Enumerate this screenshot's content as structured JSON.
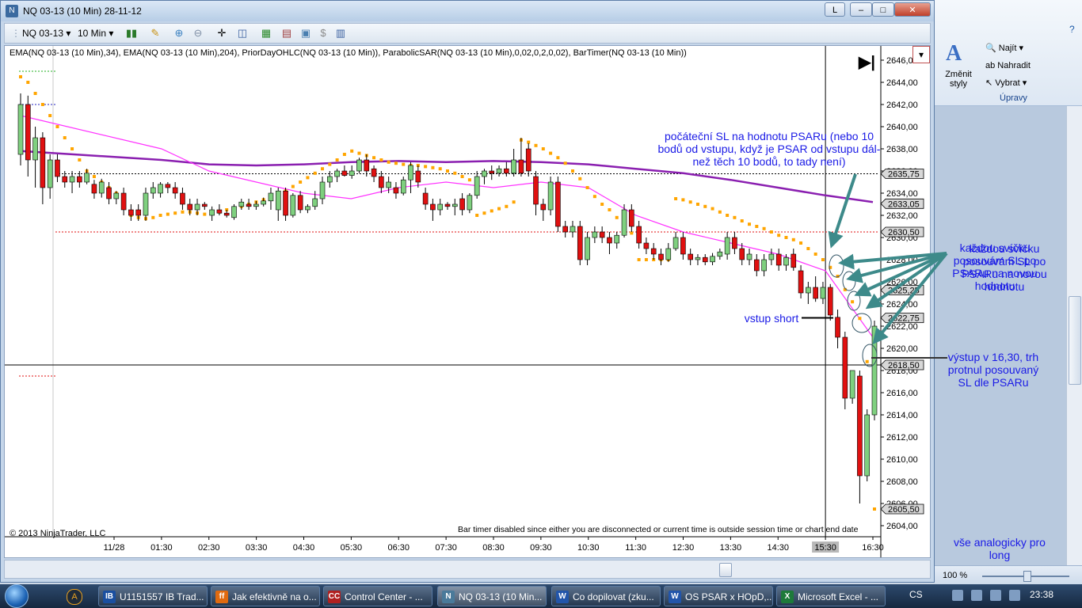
{
  "window": {
    "title": "NQ 03-13 (10 Min)  28-11-12",
    "link_button": "L",
    "minimize": "–",
    "maximize": "□",
    "close": "✕"
  },
  "toolbar": {
    "instrument": "NQ 03-13",
    "interval": "10 Min"
  },
  "chart": {
    "indicators_label": "EMA(NQ 03-13 (10 Min),34), EMA(NQ 03-13 (10 Min),204), PriorDayOHLC(NQ 03-13 (10 Min)), ParabolicSAR(NQ 03-13 (10 Min),0,02,0,2,0,02), BarTimer(NQ 03-13 (10 Min))",
    "copyright": "© 2013 NinjaTrader, LLC",
    "bar_timer_message": "Bar timer disabled since either you are disconnected or current time is outside session time or chart end date",
    "colors": {
      "up": "#7fd07f",
      "down": "#e01010",
      "ema34": "#ff33ff",
      "ema204": "#8a1fb0",
      "psar": "#ffa500",
      "annotation": "#1a1ae6",
      "arrow": "#3d8a8a"
    }
  },
  "chart_data": {
    "type": "candlestick",
    "instrument": "NQ 03-13",
    "interval": "10 Min",
    "y_axis": {
      "ylim": [
        2603,
        2647
      ],
      "ticks": [
        "2604,00",
        "2606,00",
        "2608,00",
        "2610,00",
        "2612,00",
        "2614,00",
        "2616,00",
        "2618,00",
        "2620,00",
        "2622,00",
        "2624,00",
        "2626,00",
        "2628,00",
        "2630,00",
        "2632,00",
        "2634,00",
        "2636,00",
        "2638,00",
        "2640,00",
        "2642,00",
        "2644,00",
        "2646,00"
      ]
    },
    "x_axis": {
      "ticks": [
        "11/28",
        "01:30",
        "02:30",
        "03:30",
        "04:30",
        "05:30",
        "06:30",
        "07:30",
        "08:30",
        "09:30",
        "10:30",
        "11:30",
        "12:30",
        "13:30",
        "14:30",
        "15:30",
        "16:30"
      ]
    },
    "price_markers": [
      "2635,75",
      "2633,05",
      "2630,50",
      "2625,25",
      "2622,75",
      "2618,50",
      "2605,50"
    ],
    "candles": [
      [
        2637.5,
        2643.0,
        2636.5,
        2642.0
      ],
      [
        2642.0,
        2642.8,
        2635.5,
        2637.0
      ],
      [
        2637.0,
        2640.0,
        2634.5,
        2639.0
      ],
      [
        2639.0,
        2639.5,
        2633.0,
        2634.5
      ],
      [
        2634.5,
        2637.5,
        2633.5,
        2637.0
      ],
      [
        2637.0,
        2637.5,
        2635.0,
        2635.5
      ],
      [
        2635.5,
        2636.0,
        2634.5,
        2635.0
      ],
      [
        2635.0,
        2636.0,
        2634.0,
        2635.5
      ],
      [
        2635.5,
        2636.0,
        2634.5,
        2635.0
      ],
      [
        2635.0,
        2636.2,
        2634.8,
        2635.8
      ],
      [
        2634.8,
        2635.2,
        2633.5,
        2634.0
      ],
      [
        2634.0,
        2635.3,
        2633.6,
        2635.0
      ],
      [
        2634.5,
        2635.0,
        2633.0,
        2633.5
      ],
      [
        2633.5,
        2634.2,
        2633.0,
        2634.0
      ],
      [
        2634.0,
        2634.5,
        2632.0,
        2632.5
      ],
      [
        2632.5,
        2633.0,
        2631.5,
        2632.0
      ],
      [
        2632.5,
        2633.0,
        2631.5,
        2632.0
      ],
      [
        2632.0,
        2634.5,
        2631.5,
        2634.0
      ],
      [
        2634.0,
        2635.0,
        2633.5,
        2634.5
      ],
      [
        2634.0,
        2635.0,
        2633.6,
        2634.8
      ],
      [
        2634.8,
        2635.0,
        2634.0,
        2634.5
      ],
      [
        2634.5,
        2635.0,
        2633.5,
        2634.0
      ],
      [
        2634.0,
        2634.5,
        2632.5,
        2633.0
      ],
      [
        2633.0,
        2633.5,
        2632.0,
        2632.5
      ],
      [
        2632.5,
        2633.5,
        2632.0,
        2633.0
      ],
      [
        2633.0,
        2633.2,
        2632.5,
        2632.8
      ],
      [
        2632.0,
        2632.8,
        2631.5,
        2632.5
      ],
      [
        2632.5,
        2633.0,
        2632.0,
        2632.2
      ],
      [
        2632.2,
        2632.5,
        2631.8,
        2632.0
      ],
      [
        2631.8,
        2633.0,
        2631.6,
        2632.8
      ],
      [
        2632.8,
        2633.5,
        2632.5,
        2633.2
      ],
      [
        2633.0,
        2633.5,
        2632.5,
        2632.8
      ],
      [
        2632.8,
        2633.3,
        2632.5,
        2633.0
      ],
      [
        2633.0,
        2633.6,
        2632.8,
        2633.3
      ],
      [
        2633.3,
        2634.5,
        2632.5,
        2634.0
      ],
      [
        2632.5,
        2634.5,
        2631.5,
        2634.2
      ],
      [
        2634.2,
        2634.5,
        2631.5,
        2632.0
      ],
      [
        2632.0,
        2634.0,
        2631.8,
        2633.8
      ],
      [
        2633.8,
        2634.2,
        2632.2,
        2632.5
      ],
      [
        2632.5,
        2633.0,
        2632.2,
        2632.8
      ],
      [
        2632.8,
        2634.2,
        2632.5,
        2633.5
      ],
      [
        2633.5,
        2635.5,
        2633.0,
        2635.0
      ],
      [
        2635.0,
        2636.0,
        2634.5,
        2635.5
      ],
      [
        2635.5,
        2636.2,
        2635.0,
        2636.0
      ],
      [
        2636.0,
        2636.5,
        2635.5,
        2635.6
      ],
      [
        2635.6,
        2636.5,
        2635.3,
        2636.0
      ],
      [
        2636.0,
        2637.2,
        2635.8,
        2637.0
      ],
      [
        2637.0,
        2637.5,
        2635.5,
        2636.0
      ],
      [
        2636.2,
        2636.5,
        2635.0,
        2635.5
      ],
      [
        2635.5,
        2636.0,
        2634.0,
        2634.5
      ],
      [
        2634.5,
        2635.5,
        2634.0,
        2635.0
      ],
      [
        2634.5,
        2635.0,
        2633.5,
        2634.0
      ],
      [
        2634.0,
        2635.5,
        2633.8,
        2635.2
      ],
      [
        2635.2,
        2636.8,
        2634.0,
        2636.5
      ],
      [
        2636.0,
        2636.5,
        2634.5,
        2635.0
      ],
      [
        2634.0,
        2634.5,
        2632.5,
        2633.0
      ],
      [
        2633.0,
        2633.5,
        2631.5,
        2632.5
      ],
      [
        2632.5,
        2633.5,
        2632.0,
        2633.0
      ],
      [
        2633.0,
        2633.2,
        2632.5,
        2632.8
      ],
      [
        2632.8,
        2633.5,
        2632.0,
        2633.0
      ],
      [
        2633.5,
        2634.0,
        2632.0,
        2632.5
      ],
      [
        2632.5,
        2634.0,
        2632.2,
        2633.8
      ],
      [
        2633.8,
        2636.0,
        2633.5,
        2635.5
      ],
      [
        2635.5,
        2636.2,
        2634.8,
        2636.0
      ],
      [
        2636.0,
        2636.5,
        2635.2,
        2635.8
      ],
      [
        2635.8,
        2636.5,
        2635.5,
        2636.2
      ],
      [
        2636.2,
        2636.8,
        2635.5,
        2635.8
      ],
      [
        2635.8,
        2638.0,
        2635.5,
        2637.0
      ],
      [
        2637.0,
        2639.0,
        2635.5,
        2635.8
      ],
      [
        2638.0,
        2638.5,
        2635.5,
        2636.0
      ],
      [
        2635.5,
        2636.0,
        2632.0,
        2633.0
      ],
      [
        2633.0,
        2633.5,
        2631.5,
        2632.5
      ],
      [
        2632.5,
        2635.5,
        2632.0,
        2635.0
      ],
      [
        2635.0,
        2635.5,
        2630.5,
        2631.0
      ],
      [
        2631.0,
        2631.5,
        2630.0,
        2630.5
      ],
      [
        2630.5,
        2631.5,
        2630.0,
        2631.0
      ],
      [
        2631.0,
        2631.5,
        2627.5,
        2628.0
      ],
      [
        2628.0,
        2630.5,
        2627.5,
        2630.0
      ],
      [
        2630.0,
        2631.0,
        2629.5,
        2630.5
      ],
      [
        2630.5,
        2631.0,
        2629.5,
        2630.0
      ],
      [
        2630.0,
        2630.5,
        2628.5,
        2629.5
      ],
      [
        2629.5,
        2630.5,
        2629.0,
        2630.2
      ],
      [
        2630.2,
        2633.0,
        2630.0,
        2632.5
      ],
      [
        2632.5,
        2633.0,
        2630.5,
        2631.0
      ],
      [
        2631.0,
        2631.5,
        2629.0,
        2629.5
      ],
      [
        2629.5,
        2630.0,
        2628.5,
        2629.0
      ],
      [
        2629.0,
        2629.5,
        2628.0,
        2628.5
      ],
      [
        2628.5,
        2629.0,
        2627.5,
        2628.0
      ],
      [
        2628.0,
        2629.5,
        2627.8,
        2629.0
      ],
      [
        2629.0,
        2630.5,
        2628.8,
        2630.0
      ],
      [
        2630.0,
        2630.5,
        2628.0,
        2628.5
      ],
      [
        2628.5,
        2629.0,
        2627.5,
        2628.0
      ],
      [
        2628.0,
        2628.5,
        2627.5,
        2628.2
      ],
      [
        2628.2,
        2628.5,
        2627.5,
        2627.8
      ],
      [
        2627.8,
        2628.6,
        2627.5,
        2628.3
      ],
      [
        2628.3,
        2629.0,
        2628.0,
        2628.7
      ],
      [
        2628.5,
        2630.5,
        2628.0,
        2630.0
      ],
      [
        2630.0,
        2630.5,
        2628.5,
        2629.0
      ],
      [
        2629.0,
        2629.5,
        2627.5,
        2628.0
      ],
      [
        2628.0,
        2629.0,
        2627.5,
        2628.5
      ],
      [
        2628.0,
        2628.5,
        2626.5,
        2627.0
      ],
      [
        2627.0,
        2628.5,
        2626.5,
        2628.0
      ],
      [
        2628.0,
        2629.0,
        2627.5,
        2628.5
      ],
      [
        2628.5,
        2629.0,
        2627.0,
        2627.5
      ],
      [
        2627.5,
        2628.5,
        2627.0,
        2628.2
      ],
      [
        2628.5,
        2629.0,
        2627.0,
        2627.3
      ],
      [
        2627.0,
        2627.5,
        2624.5,
        2625.0
      ],
      [
        2625.0,
        2626.0,
        2624.0,
        2625.5
      ],
      [
        2625.5,
        2626.5,
        2624.2,
        2624.5
      ],
      [
        2624.5,
        2626.0,
        2624.0,
        2625.5
      ],
      [
        2625.5,
        2625.8,
        2622.5,
        2623.0
      ],
      [
        2622.8,
        2623.5,
        2620.0,
        2621.0
      ],
      [
        2621.0,
        2621.5,
        2614.5,
        2615.5
      ],
      [
        2615.5,
        2618.0,
        2615.0,
        2618.0
      ],
      [
        2617.5,
        2618.0,
        2606.0,
        2608.5
      ],
      [
        2608.5,
        2614.5,
        2608.0,
        2614.0
      ],
      [
        2614.0,
        2622.5,
        2613.5,
        2622.0
      ]
    ],
    "ema34_at_ticks": [
      2641.0,
      2638.0,
      2636.0,
      2635.0,
      2634.0,
      2633.5,
      2634.5,
      2635.0,
      2634.5,
      2635.0,
      2634.5,
      2632.0,
      2630.5,
      2629.5,
      2628.5,
      2627.0,
      2621.0
    ],
    "ema204_at_ticks": [
      2637.8,
      2637.0,
      2636.6,
      2636.5,
      2636.6,
      2636.8,
      2636.9,
      2636.8,
      2636.9,
      2636.8,
      2636.6,
      2636.2,
      2635.8,
      2635.2,
      2634.5,
      2633.8,
      2633.2
    ],
    "psar": [
      2644.5,
      2644.0,
      2643.0,
      2642.0,
      2641.0,
      2640.0,
      2639.0,
      2638.0,
      2637.0,
      2636.0,
      2635.5,
      2635.0,
      2634.5,
      2634.0,
      2633.0,
      2632.0,
      2631.8,
      2631.7,
      2631.8,
      2632.0,
      2632.1,
      2632.2,
      2632.3,
      2632.3,
      2632.2,
      2632.1,
      2632.2,
      2632.3,
      2632.5,
      2632.6,
      2632.8,
      2633.0,
      2633.2,
      2633.4,
      2633.6,
      2633.9,
      2634.2,
      2634.6,
      2635.0,
      2635.4,
      2635.8,
      2636.2,
      2636.6,
      2637.0,
      2637.5,
      2637.8,
      2637.6,
      2637.4,
      2637.2,
      2637.0,
      2636.8,
      2636.7,
      2636.6,
      2636.5,
      2636.5,
      2636.4,
      2636.3,
      2636.2,
      2636.0,
      2635.8,
      2635.5,
      2635.2,
      2632.0,
      2632.2,
      2632.4,
      2632.6,
      2632.8,
      2633.2,
      2638.8,
      2638.6,
      2638.3,
      2638.0,
      2637.6,
      2637.2,
      2636.7,
      2636.0,
      2635.3,
      2634.5,
      2633.7,
      2633.0,
      2632.5,
      2631.8,
      2631.0,
      2630.4,
      2628.0,
      2628.0,
      2628.0,
      2628.0,
      2628.0,
      2633.5,
      2633.4,
      2633.2,
      2633.0,
      2632.8,
      2632.6,
      2632.3,
      2632.0,
      2631.8,
      2631.5,
      2631.2,
      2631.0,
      2630.8,
      2630.5,
      2630.2,
      2630.0,
      2629.8,
      2629.5,
      2629.0,
      2628.5,
      2628.0,
      2627.3,
      2626.5,
      2625.3,
      2624.2,
      2622.7,
      2618.8,
      2605.5
    ],
    "prior_day_levels": {
      "high": 2645.0,
      "low": 2617.5,
      "close": 2630.5,
      "open": 2642.0,
      "open_level": 2635.75
    },
    "crosshair_price": 2618.5,
    "session_end_time": "15:30"
  },
  "annotations": {
    "initial_sl": "počáteční SL na hodnotu PSARu (nebo 10 bodů od vstupu, když je PSAR od vstupu dál-než těch 10 bodů, to tady není)",
    "move_sl": "každou svíčku posouvám SL po PSARu na novou hodnotu",
    "entry": "vstup short",
    "exit": "výstup v 16,30, trh protnul posouvaný SL dle PSARu",
    "long_note": "vše analogicky pro long"
  },
  "word": {
    "find": "Najít",
    "replace": "Nahradit",
    "select": "Vybrat",
    "change_styles": "Změnit styly",
    "editing_group": "Úpravy",
    "zoom": "100 %"
  },
  "taskbar": {
    "items": [
      "U1151557 IB Trad...",
      "Jak efektivně na o...",
      "Control Center - ...",
      "NQ 03-13 (10 Min...",
      "Co dopilovat (zku...",
      "OS PSAR x HOpD,...",
      "Microsoft Excel - ..."
    ],
    "language": "CS",
    "clock": "23:38"
  }
}
